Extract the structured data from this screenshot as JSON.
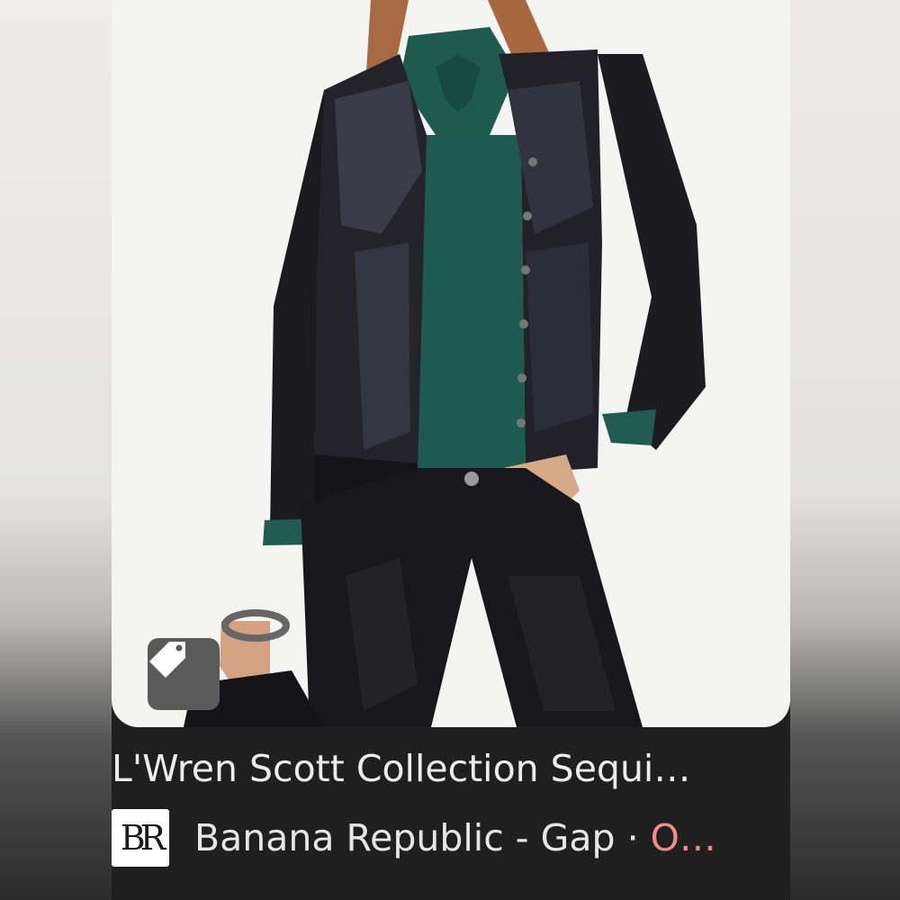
{
  "result": {
    "title": "L'Wren Scott Collection Sequi…",
    "source_logo_text": "BR",
    "source_name": "Banana Republic - Gap",
    "separator": " · ",
    "status_truncated": "O…",
    "tag_icon": "price-tag-icon",
    "image_alt": "Model wearing black sequin cardigan over green blouse with black lace pants"
  },
  "colors": {
    "card_background": "#1f1f1f",
    "title_text": "#ececec",
    "status_accent": "#f28b82"
  }
}
